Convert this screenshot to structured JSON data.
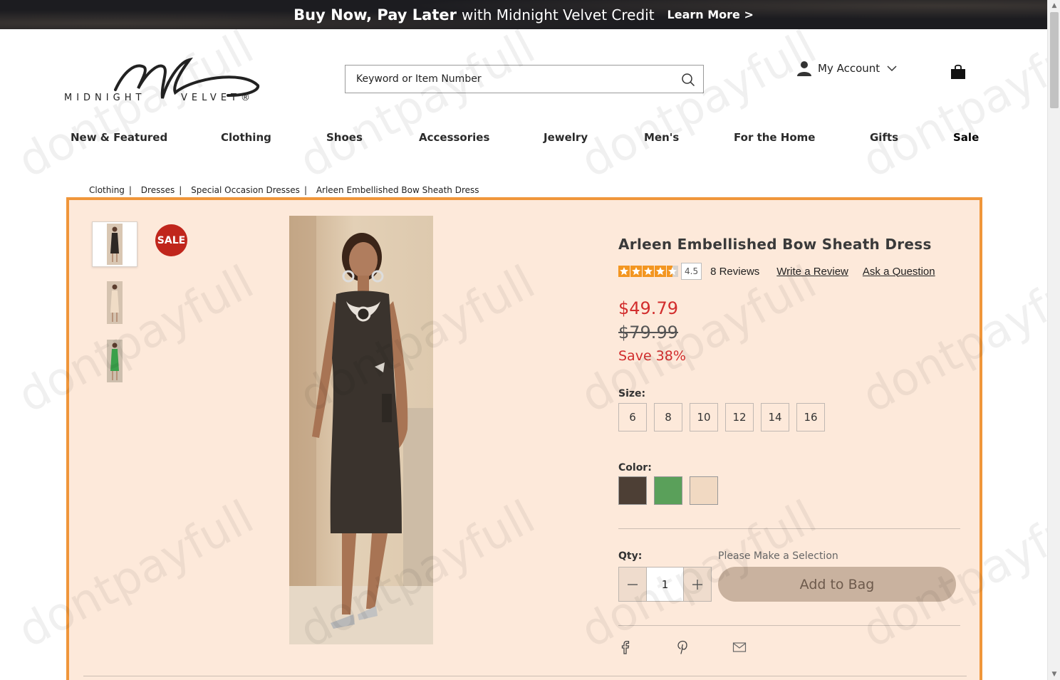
{
  "promo": {
    "bold": "Buy Now, Pay Later",
    "text": "with Midnight Velvet Credit",
    "link": "Learn More >"
  },
  "logo": {
    "word1": "MIDNIGHT",
    "word2": "VELVET®"
  },
  "search": {
    "placeholder": "Keyword or Item Number"
  },
  "account": {
    "label": "My Account"
  },
  "nav": {
    "items": [
      "New & Featured",
      "Clothing",
      "Shoes",
      "Accessories",
      "Jewelry",
      "Men's",
      "For the Home",
      "Gifts",
      "Sale"
    ]
  },
  "breadcrumb": [
    "Clothing",
    "Dresses",
    "Special Occasion Dresses",
    "Arleen Embellished Bow Sheath Dress"
  ],
  "product": {
    "badge": "SALE",
    "title": "Arleen Embellished Bow Sheath Dress",
    "rating": "4.5",
    "rating_value": 4.5,
    "reviews": "8 Reviews",
    "write_review": "Write a Review",
    "ask_question": "Ask a Question",
    "sale_price": "$49.79",
    "orig_price": "$79.99",
    "save": "Save 38%",
    "size_label": "Size:",
    "sizes": [
      "6",
      "8",
      "10",
      "12",
      "14",
      "16"
    ],
    "color_label": "Color:",
    "colors": [
      "#4d3f35",
      "#5aa05a",
      "#f1d9c2"
    ],
    "qty_label": "Qty:",
    "qty_value": "1",
    "selection_msg": "Please Make a Selection",
    "add_to_bag": "Add to Bag"
  },
  "watermark": "dontpayfull",
  "colors": {
    "accent_border": "#f0963a",
    "panel_bg": "#fde9da",
    "sale_red": "#d22d2d",
    "badge_red": "#c0261c",
    "button_bg": "#c9b29f"
  }
}
